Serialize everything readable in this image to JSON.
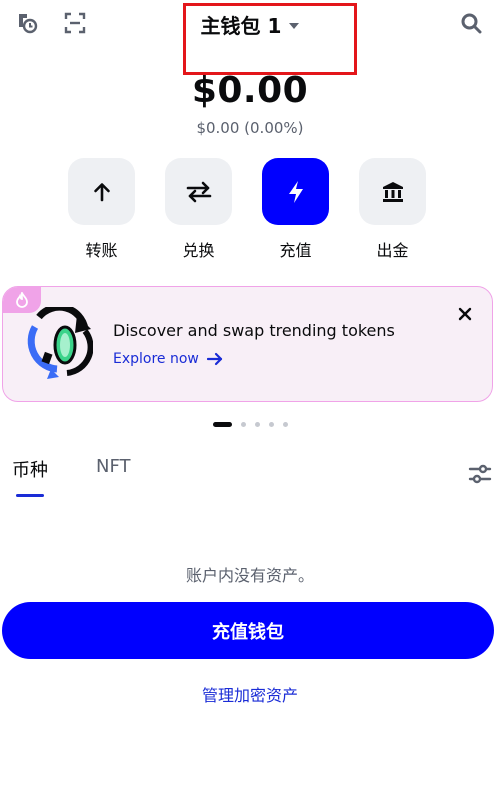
{
  "header": {
    "wallet_name": "主钱包 1",
    "icons": [
      "history-icon",
      "scan-icon",
      "search-icon"
    ]
  },
  "portfolio": {
    "balance": "$0.00",
    "change": "$0.00 (0.00%)"
  },
  "actions": [
    {
      "label": "转账",
      "icon": "arrow-up-icon"
    },
    {
      "label": "兑换",
      "icon": "swap-icon"
    },
    {
      "label": "充值",
      "icon": "lightning-icon"
    },
    {
      "label": "出金",
      "icon": "bank-icon"
    }
  ],
  "promo": {
    "title": "Discover and swap trending tokens",
    "link": "Explore now",
    "carousel_active_index": 0,
    "carousel_count": 5
  },
  "tabs": [
    {
      "label": "币种",
      "active": true
    },
    {
      "label": "NFT",
      "active": false
    }
  ],
  "assets": {
    "empty_message": "账户内没有资产。",
    "cta_label": "充值钱包",
    "manage_label": "管理加密资产"
  },
  "colors": {
    "primary": "#0000ff",
    "link": "#1a2cd6",
    "highlight": "#e3161a",
    "promo_border": "#f0a3e8"
  }
}
